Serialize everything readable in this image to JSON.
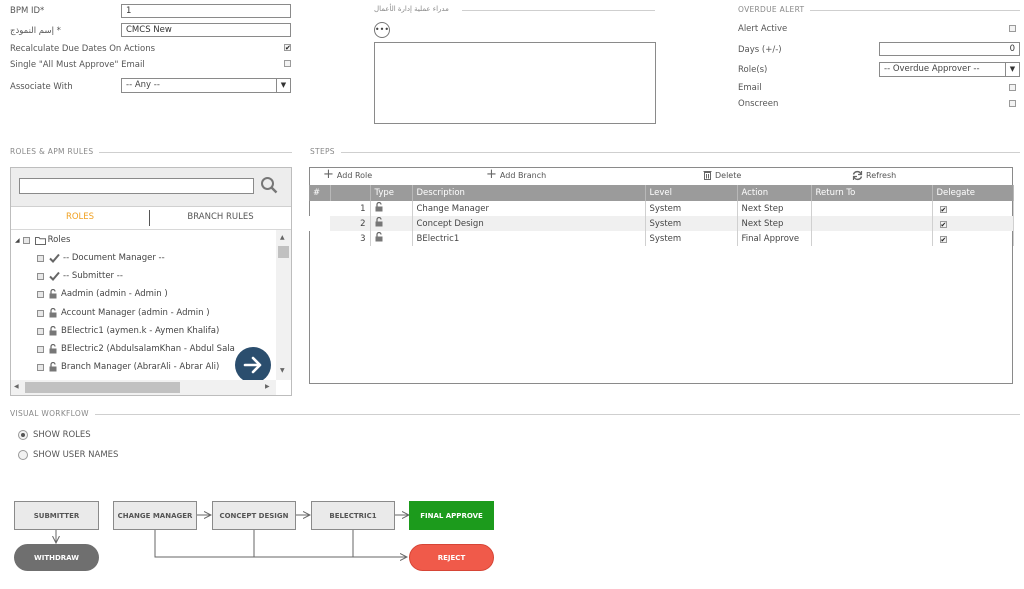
{
  "form": {
    "bpm_id_label": "BPM ID*",
    "bpm_id_value": "1",
    "model_name_label": "إسم النموذج *",
    "model_name_value": "CMCS New",
    "recalculate_label": "Recalculate Due Dates On Actions",
    "recalculate_checked": true,
    "single_approve_label": "Single \"All Must Approve\" Email",
    "single_approve_checked": false,
    "associate_label": "Associate With",
    "associate_value": "-- Any --"
  },
  "business_managers": {
    "title": "مدراء عملية إدارة الأعمال"
  },
  "overdue": {
    "title": "OVERDUE ALERT",
    "alert_active_label": "Alert Active",
    "days_label": "Days (+/-)",
    "days_value": "0",
    "roles_label": "Role(s)",
    "roles_value": "-- Overdue Approver --",
    "email_label": "Email",
    "onscreen_label": "Onscreen"
  },
  "roles_panel": {
    "title": "ROLES & APM RULES",
    "tab_roles": "ROLES",
    "tab_branch_rules": "BRANCH RULES",
    "root": "Roles",
    "items": [
      {
        "icon": "check-icon",
        "label": "-- Document Manager --"
      },
      {
        "icon": "check-icon",
        "label": "-- Submitter --"
      },
      {
        "icon": "lock-open-icon",
        "label": "Aadmin (admin - Admin )"
      },
      {
        "icon": "lock-open-icon",
        "label": "Account Manager (admin - Admin )"
      },
      {
        "icon": "lock-open-icon",
        "label": "BElectric1 (aymen.k - Aymen Khalifa)"
      },
      {
        "icon": "lock-open-icon",
        "label": "BElectric2 (AbdulsalamKhan - Abdul Sala"
      },
      {
        "icon": "lock-open-icon",
        "label": "Branch Manager (AbrarAli - Abrar Ali)"
      }
    ]
  },
  "steps": {
    "title": "STEPS",
    "toolbar": {
      "add_role": "Add Role",
      "add_branch": "Add Branch",
      "delete": "Delete",
      "refresh": "Refresh"
    },
    "columns": [
      "#",
      "Type",
      "Description",
      "Level",
      "Action",
      "Return To",
      "Delegate"
    ],
    "rows": [
      {
        "num": "1",
        "description": "Change Manager",
        "level": "System",
        "action": "Next Step",
        "return_to": "",
        "delegate": true
      },
      {
        "num": "2",
        "description": "Concept Design",
        "level": "System",
        "action": "Next Step",
        "return_to": "",
        "delegate": true
      },
      {
        "num": "3",
        "description": "BElectric1",
        "level": "System",
        "action": "Final Approve",
        "return_to": "",
        "delegate": true
      }
    ]
  },
  "workflow": {
    "title": "VISUAL WORKFLOW",
    "show_roles": "SHOW ROLES",
    "show_user_names": "SHOW USER NAMES",
    "nodes": {
      "submitter": "SUBMITTER",
      "withdraw": "WITHDRAW",
      "change_manager": "CHANGE MANAGER",
      "concept_design": "CONCEPT DESIGN",
      "belectric1": "BELECTRIC1",
      "final_approve": "FINAL APPROVE",
      "reject": "REJECT"
    },
    "colors": {
      "final_approve": "#1c9b1c",
      "reject": "#f05a4a",
      "withdraw": "#6f6f6f"
    }
  }
}
